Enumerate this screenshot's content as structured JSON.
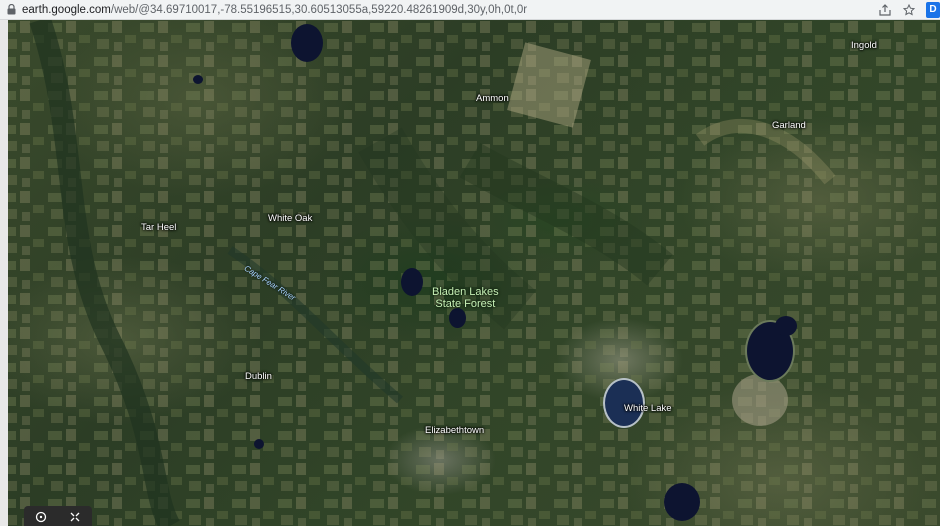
{
  "browser": {
    "url_host": "earth.google.com",
    "url_path": "/web/@34.69710017,-78.55196515,30.60513055a,59220.48261909d,30y,0h,0t,0r",
    "extension_badge": "D"
  },
  "map": {
    "places": [
      {
        "id": "ingold",
        "name": "Ingold"
      },
      {
        "id": "ammon",
        "name": "Ammon"
      },
      {
        "id": "garland",
        "name": "Garland"
      },
      {
        "id": "tar-heel",
        "name": "Tar Heel"
      },
      {
        "id": "white-oak",
        "name": "White Oak"
      },
      {
        "id": "dublin",
        "name": "Dublin"
      },
      {
        "id": "white-lake",
        "name": "White Lake"
      },
      {
        "id": "elizabethtown",
        "name": "Elizabethtown"
      }
    ],
    "forest_line1": "Bladen Lakes",
    "forest_line2": "State Forest",
    "river": "Cape Fear River"
  },
  "icons": {
    "lock": "lock-icon",
    "share": "share-icon",
    "star": "star-icon",
    "compass": "compass-icon",
    "fullscreen": "fullscreen-icon"
  },
  "colors": {
    "lake": "#0d1430",
    "place_label": "#ffffff",
    "forest_label": "#c7f0b6",
    "river_label": "#a9d4ff"
  }
}
